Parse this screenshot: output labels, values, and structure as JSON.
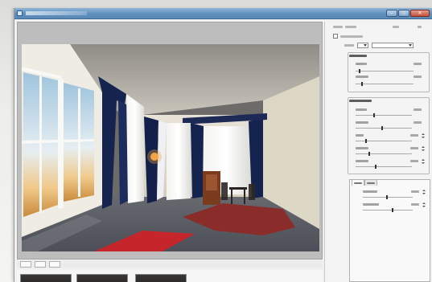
{
  "colors": {
    "titlebar": "#5f8fbe",
    "carpet_red": "#c5262b",
    "curtain_navy": "#15234f",
    "wall_cream": "#e3ddce"
  },
  "window": {
    "minimize_icon": "minimize-icon",
    "maximize_icon": "maximize-icon",
    "close_icon": "close-icon"
  },
  "icons": {
    "app": "app-icon",
    "dropdown_arrow": "chevron-down-icon"
  }
}
